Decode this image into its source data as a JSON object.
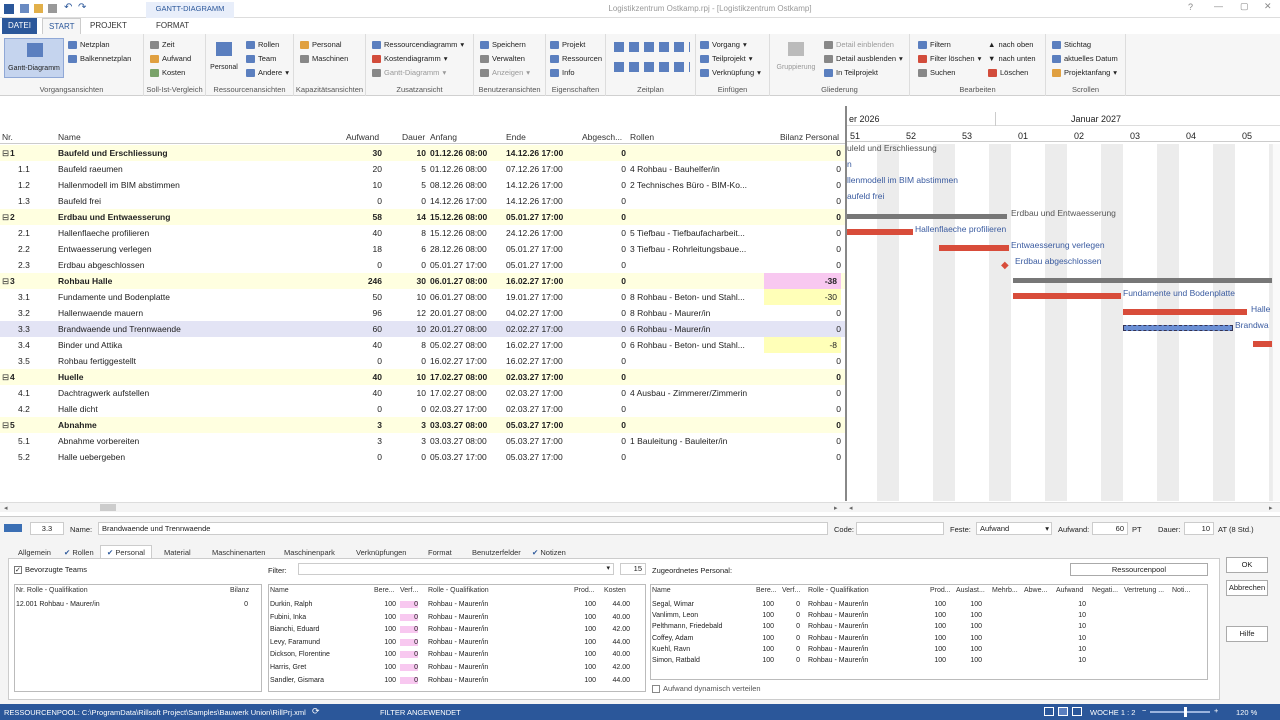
{
  "window": {
    "title": "Logistikzentrum Ostkamp.rpj - [Logistikzentrum Ostkamp]"
  },
  "ribbon_tabs": {
    "context": "GANTT-DIAGRAMM",
    "file": "DATEI",
    "start": "START",
    "project": "PROJEKT",
    "format": "FORMAT"
  },
  "ribbon": {
    "g1": {
      "big": "Gantt-Diagramm",
      "a": "Netzplan",
      "b": "Balkennetzplan",
      "label": "Vorgangsansichten"
    },
    "g2": {
      "a": "Zeit",
      "b": "Aufwand",
      "c": "Kosten",
      "label": "Soll-Ist-Vergleich"
    },
    "g3": {
      "big": "Personal",
      "a": "Rollen",
      "b": "Team",
      "c": "Andere",
      "label": "Ressourcenansichten"
    },
    "g4": {
      "a": "Personal",
      "b": "Maschinen",
      "label": "Kapazitätsansichten"
    },
    "g5": {
      "a": "Ressourcendiagramm",
      "b": "Kostendiagramm",
      "c": "Gantt-Diagramm",
      "label": "Zusatzansicht"
    },
    "g6": {
      "a": "Speichern",
      "b": "Verwalten",
      "c": "Anzeigen",
      "label": "Benutzeransichten"
    },
    "g7": {
      "a": "Projekt",
      "b": "Ressourcen",
      "c": "Info",
      "label": "Eigenschaften"
    },
    "g8": {
      "label": "Zeitplan"
    },
    "g9": {
      "a": "Vorgang",
      "b": "Teilprojekt",
      "c": "Verknüpfung",
      "label": "Einfügen"
    },
    "g10": {
      "big": "Gruppierung",
      "a": "Detail einblenden",
      "b": "Detail ausblenden",
      "c": "In Teilprojekt",
      "label": "Gliederung"
    },
    "g11": {
      "a": "Filtern",
      "b": "Filter löschen",
      "c": "Suchen",
      "d": "nach oben",
      "e": "nach unten",
      "f": "Löschen",
      "label": "Bearbeiten"
    },
    "g12": {
      "a": "Stichtag",
      "b": "aktuelles Datum",
      "c": "Projektanfang",
      "label": "Scrollen"
    }
  },
  "grid": {
    "headers": {
      "nr": "Nr.",
      "name": "Name",
      "aufwand": "Aufwand",
      "dauer": "Dauer",
      "anfang": "Anfang",
      "ende": "Ende",
      "abgesch": "Abgesch...",
      "rollen": "Rollen",
      "bilanz": "Bilanz Personal"
    },
    "rows": [
      {
        "nr": "1",
        "name": "Baufeld und Erschliessung",
        "aufwand": "30",
        "dauer": "10",
        "anfang": "01.12.26 08:00",
        "ende": "14.12.26 17:00",
        "abg": "0",
        "rollen": "",
        "bilanz": "0",
        "type": "summary"
      },
      {
        "nr": "1.1",
        "name": "Baufeld raeumen",
        "aufwand": "20",
        "dauer": "5",
        "anfang": "01.12.26 08:00",
        "ende": "07.12.26 17:00",
        "abg": "0",
        "rollen": "4 Rohbau - Bauhelfer/in",
        "bilanz": "0"
      },
      {
        "nr": "1.2",
        "name": "Hallenmodell im BIM abstimmen",
        "aufwand": "10",
        "dauer": "5",
        "anfang": "08.12.26 08:00",
        "ende": "14.12.26 17:00",
        "abg": "0",
        "rollen": "2 Technisches Büro - BIM-Ko...",
        "bilanz": "0"
      },
      {
        "nr": "1.3",
        "name": "Baufeld frei",
        "aufwand": "0",
        "dauer": "0",
        "anfang": "14.12.26 17:00",
        "ende": "14.12.26 17:00",
        "abg": "0",
        "rollen": "",
        "bilanz": "0"
      },
      {
        "nr": "2",
        "name": "Erdbau und Entwaesserung",
        "aufwand": "58",
        "dauer": "14",
        "anfang": "15.12.26 08:00",
        "ende": "05.01.27 17:00",
        "abg": "0",
        "rollen": "",
        "bilanz": "0",
        "type": "summary"
      },
      {
        "nr": "2.1",
        "name": "Hallenflaeche profilieren",
        "aufwand": "40",
        "dauer": "8",
        "anfang": "15.12.26 08:00",
        "ende": "24.12.26 17:00",
        "abg": "0",
        "rollen": "5 Tiefbau - Tiefbaufacharbeit...",
        "bilanz": "0"
      },
      {
        "nr": "2.2",
        "name": "Entwaesserung verlegen",
        "aufwand": "18",
        "dauer": "6",
        "anfang": "28.12.26 08:00",
        "ende": "05.01.27 17:00",
        "abg": "0",
        "rollen": "3 Tiefbau - Rohrleitungsbaue...",
        "bilanz": "0"
      },
      {
        "nr": "2.3",
        "name": "Erdbau abgeschlossen",
        "aufwand": "0",
        "dauer": "0",
        "anfang": "05.01.27 17:00",
        "ende": "05.01.27 17:00",
        "abg": "0",
        "rollen": "",
        "bilanz": "0"
      },
      {
        "nr": "3",
        "name": "Rohbau Halle",
        "aufwand": "246",
        "dauer": "30",
        "anfang": "06.01.27 08:00",
        "ende": "16.02.27 17:00",
        "abg": "0",
        "rollen": "",
        "bilanz": "-38",
        "type": "summary",
        "hl": "pink"
      },
      {
        "nr": "3.1",
        "name": "Fundamente und Bodenplatte",
        "aufwand": "50",
        "dauer": "10",
        "anfang": "06.01.27 08:00",
        "ende": "19.01.27 17:00",
        "abg": "0",
        "rollen": "8 Rohbau - Beton- und Stahl...",
        "bilanz": "-30",
        "hl": "yel"
      },
      {
        "nr": "3.2",
        "name": "Hallenwaende mauern",
        "aufwand": "96",
        "dauer": "12",
        "anfang": "20.01.27 08:00",
        "ende": "04.02.27 17:00",
        "abg": "0",
        "rollen": "8 Rohbau - Maurer/in",
        "bilanz": "0"
      },
      {
        "nr": "3.3",
        "name": "Brandwaende und Trennwaende",
        "aufwand": "60",
        "dauer": "10",
        "anfang": "20.01.27 08:00",
        "ende": "02.02.27 17:00",
        "abg": "0",
        "rollen": "6 Rohbau - Maurer/in",
        "bilanz": "0",
        "type": "selected"
      },
      {
        "nr": "3.4",
        "name": "Binder und Attika",
        "aufwand": "40",
        "dauer": "8",
        "anfang": "05.02.27 08:00",
        "ende": "16.02.27 17:00",
        "abg": "0",
        "rollen": "6 Rohbau - Beton- und Stahl...",
        "bilanz": "-8",
        "hl": "yel"
      },
      {
        "nr": "3.5",
        "name": "Rohbau fertiggestellt",
        "aufwand": "0",
        "dauer": "0",
        "anfang": "16.02.27 17:00",
        "ende": "16.02.27 17:00",
        "abg": "0",
        "rollen": "",
        "bilanz": "0"
      },
      {
        "nr": "4",
        "name": "Huelle",
        "aufwand": "40",
        "dauer": "10",
        "anfang": "17.02.27 08:00",
        "ende": "02.03.27 17:00",
        "abg": "0",
        "rollen": "",
        "bilanz": "0",
        "type": "summary"
      },
      {
        "nr": "4.1",
        "name": "Dachtragwerk aufstellen",
        "aufwand": "40",
        "dauer": "10",
        "anfang": "17.02.27 08:00",
        "ende": "02.03.27 17:00",
        "abg": "0",
        "rollen": "4 Ausbau - Zimmerer/Zimmerin",
        "bilanz": "0"
      },
      {
        "nr": "4.2",
        "name": "Halle dicht",
        "aufwand": "0",
        "dauer": "0",
        "anfang": "02.03.27 17:00",
        "ende": "02.03.27 17:00",
        "abg": "0",
        "rollen": "",
        "bilanz": "0"
      },
      {
        "nr": "5",
        "name": "Abnahme",
        "aufwand": "3",
        "dauer": "3",
        "anfang": "03.03.27 08:00",
        "ende": "05.03.27 17:00",
        "abg": "0",
        "rollen": "",
        "bilanz": "0",
        "type": "summary"
      },
      {
        "nr": "5.1",
        "name": "Abnahme vorbereiten",
        "aufwand": "3",
        "dauer": "3",
        "anfang": "03.03.27 08:00",
        "ende": "05.03.27 17:00",
        "abg": "0",
        "rollen": "1 Bauleitung - Bauleiter/in",
        "bilanz": "0"
      },
      {
        "nr": "5.2",
        "name": "Halle uebergeben",
        "aufwand": "0",
        "dauer": "0",
        "anfang": "05.03.27 17:00",
        "ende": "05.03.27 17:00",
        "abg": "0",
        "rollen": "",
        "bilanz": "0"
      }
    ]
  },
  "gantt": {
    "nav": "<<",
    "months": [
      "er 2026",
      "Januar 2027"
    ],
    "weeks": [
      "51",
      "52",
      "53",
      "01",
      "02",
      "03",
      "04",
      "05"
    ],
    "labels": [
      "uleld und Erschliessung",
      "n",
      "llenmodell im BIM abstimmen",
      "aufeld frei",
      "Erdbau und Entwaesserung",
      "Hallenflaeche profilieren",
      "Entwaesserung verlegen",
      "Erdbau abgeschlossen",
      "Fundamente und Bodenplatte",
      "Halle",
      "Brandwa"
    ]
  },
  "detail": {
    "nr": "3.3",
    "name_label": "Name:",
    "name": "Brandwaende und Trennwaende",
    "code_label": "Code:",
    "feste_label": "Feste:",
    "feste": "Aufwand",
    "aufwand_label": "Aufwand:",
    "aufwand": "60",
    "aufwand_unit": "PT",
    "dauer_label": "Dauer:",
    "dauer": "10",
    "dauer_unit": "AT (8 Std.)",
    "tabs": [
      "Allgemein",
      "Rollen",
      "Personal",
      "Material",
      "Maschinenarten",
      "Maschinenpark",
      "Verknüpfungen",
      "Format",
      "Benutzerfelder",
      "Notizen"
    ],
    "bevorzugte": "Bevorzugte Teams",
    "filter_label": "Filter:",
    "filter_count": "15",
    "zugeordnet_label": "Zugeordnetes Personal:",
    "ressourcenpool_btn": "Ressourcenpool",
    "teams": {
      "headers": [
        "Nr. Rolle - Qualifikation",
        "Bilanz"
      ],
      "rows": [
        [
          "12.001 Rohbau - Maurer/in",
          "0"
        ]
      ]
    },
    "pool": {
      "headers": [
        "Name",
        "Bere...",
        "Verf...",
        "Rolle - Qualifikation",
        "Prod...",
        "Kosten"
      ],
      "rows": [
        [
          "Durkin, Ralph",
          "100",
          "0",
          "Rohbau - Maurer/in",
          "100",
          "44.00"
        ],
        [
          "Fubini, Inka",
          "100",
          "0",
          "Rohbau - Maurer/in",
          "100",
          "40.00"
        ],
        [
          "Bianchi, Eduard",
          "100",
          "0",
          "Rohbau - Maurer/in",
          "100",
          "42.00"
        ],
        [
          "Levy, Faramund",
          "100",
          "0",
          "Rohbau - Maurer/in",
          "100",
          "44.00"
        ],
        [
          "Dickson, Florentine",
          "100",
          "0",
          "Rohbau - Maurer/in",
          "100",
          "40.00"
        ],
        [
          "Harris, Gret",
          "100",
          "0",
          "Rohbau - Maurer/in",
          "100",
          "42.00"
        ],
        [
          "Sandler, Gismara",
          "100",
          "0",
          "Rohbau - Maurer/in",
          "100",
          "44.00"
        ]
      ]
    },
    "assigned": {
      "headers": [
        "Name",
        "Bere...",
        "Verf...",
        "Rolle - Qualifikation",
        "Prod...",
        "Auslast...",
        "Mehrb...",
        "Abwe...",
        "Aufwand",
        "Negati...",
        "Vertretung ...",
        "Noti..."
      ],
      "rows": [
        [
          "Segal, Wimar",
          "100",
          "0",
          "Rohbau - Maurer/in",
          "100",
          "100",
          "",
          "",
          "10"
        ],
        [
          "Vanlimm, Leon",
          "100",
          "0",
          "Rohbau - Maurer/in",
          "100",
          "100",
          "",
          "",
          "10"
        ],
        [
          "Pelthmann, Friedebald",
          "100",
          "0",
          "Rohbau - Maurer/in",
          "100",
          "100",
          "",
          "",
          "10"
        ],
        [
          "Coffey, Adam",
          "100",
          "0",
          "Rohbau - Maurer/in",
          "100",
          "100",
          "",
          "",
          "10"
        ],
        [
          "Kuehl, Ravn",
          "100",
          "0",
          "Rohbau - Maurer/in",
          "100",
          "100",
          "",
          "",
          "10"
        ],
        [
          "Simon, Ratbald",
          "100",
          "0",
          "Rohbau - Maurer/in",
          "100",
          "100",
          "",
          "",
          "10"
        ]
      ]
    },
    "dyn": "Aufwand dynamisch verteilen",
    "ok": "OK",
    "cancel": "Abbrechen",
    "help": "Hilfe"
  },
  "status": {
    "path": "RESSOURCENPOOL: C:\\ProgramData\\Rillsoft Project\\Samples\\Bauwerk Union\\RillPrj.xml",
    "filter": "FILTER ANGEWENDET",
    "scale": "WOCHE 1 : 2",
    "zoom": "120 %"
  }
}
